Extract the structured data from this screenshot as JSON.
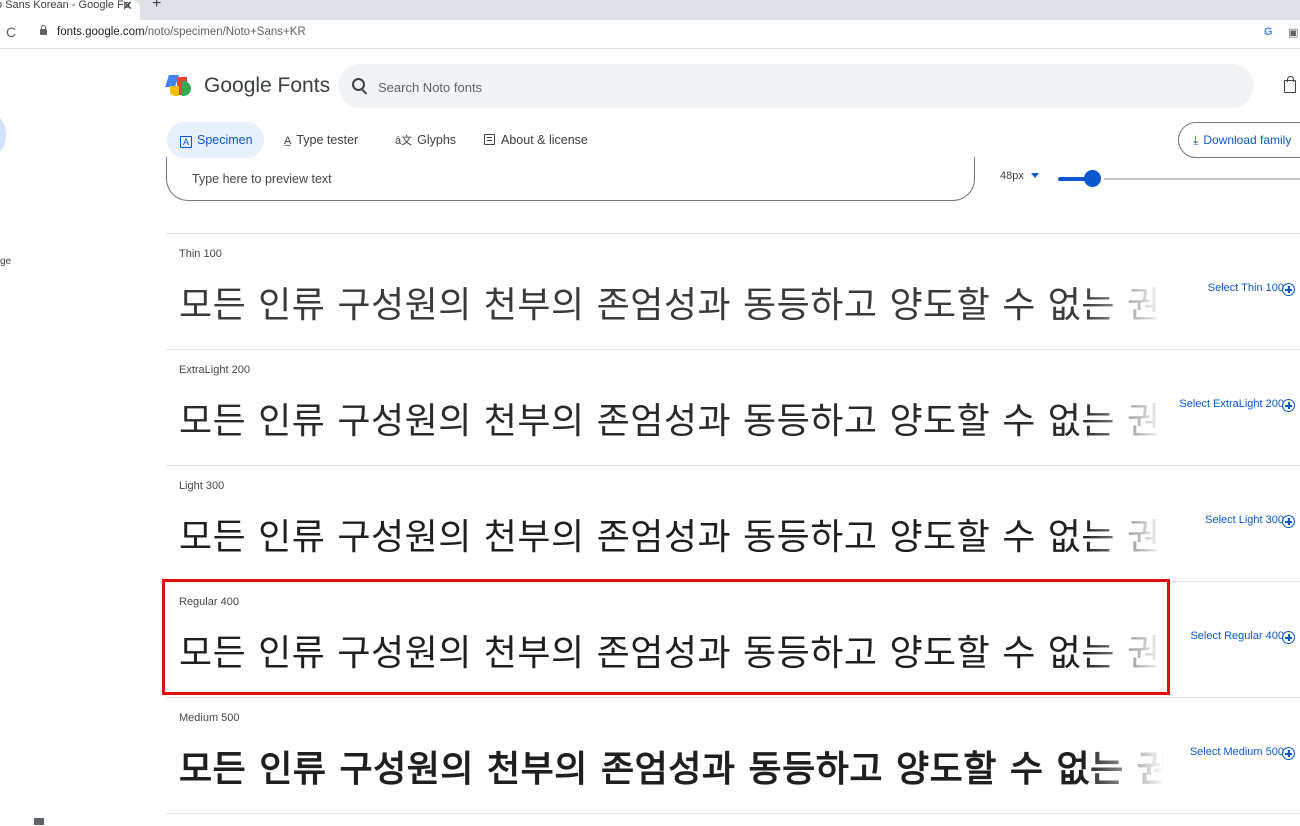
{
  "browser": {
    "tab_title": "o Sans Korean - Google Fo",
    "tab_close": "✕",
    "new_tab": "+",
    "url_host": "fonts.google.com",
    "url_path": "/noto/specimen/Noto+Sans+KR",
    "ext_g": "G",
    "ext_translate": " "
  },
  "rail": {
    "text": "ge"
  },
  "header": {
    "brand": "Google Fonts",
    "search_placeholder": "Search Noto fonts"
  },
  "tabs": {
    "specimen": "Specimen",
    "type_tester": "Type tester",
    "glyphs": "Glyphs",
    "about": "About & license",
    "download": "Download family"
  },
  "preview": {
    "placeholder": "Type here to preview text",
    "size": "48px"
  },
  "styles": [
    {
      "label": "Thin 100",
      "select": "Select Thin 100",
      "sample": "모든 인류 구성원의 천부의 존엄성과 동등하고 양도할 수 없는 권리"
    },
    {
      "label": "ExtraLight 200",
      "select": "Select ExtraLight 200",
      "sample": "모든 인류 구성원의 천부의 존엄성과 동등하고 양도할 수 없는 권리"
    },
    {
      "label": "Light 300",
      "select": "Select Light 300",
      "sample": "모든 인류 구성원의 천부의 존엄성과 동등하고 양도할 수 없는 권리"
    },
    {
      "label": "Regular 400",
      "select": "Select Regular 400",
      "sample": "모든 인류 구성원의 천부의 존엄성과 동등하고 양도할 수 없는 권리"
    },
    {
      "label": "Medium 500",
      "select": "Select Medium 500",
      "sample": "모든 인류 구성원의 천부의 존엄성과 동등하고 양도할 수 없는 권리"
    }
  ],
  "colors": {
    "accent": "#0b57d0",
    "highlight": "#e01010"
  }
}
